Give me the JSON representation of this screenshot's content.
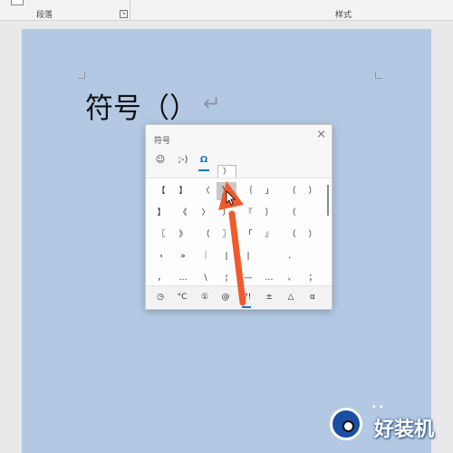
{
  "ribbon": {
    "paragraph_group": "段落",
    "styles_group": "样式"
  },
  "document": {
    "text": "符号（）",
    "paragraph_mark": "↵"
  },
  "symbol_panel": {
    "title": "符号",
    "close": "×",
    "tabs": {
      "emoji": "☺",
      "kaomoji": ";-)",
      "symbols": "Ω"
    },
    "tooltip": "）",
    "grid_rows": [
      [
        "【",
        "】",
        "〈",
        "）",
        "｛",
        "」",
        "（",
        "）"
      ],
      [
        "】",
        "《",
        "〉",
        "）",
        "『",
        "〕",
        "（",
        ""
      ],
      [
        "〖",
        "》",
        "（",
        "〗",
        "「",
        "』",
        "（",
        "）"
      ],
      [
        "‹",
        "»",
        "｜",
        "|",
        "|",
        "",
        "．",
        ""
      ],
      [
        "，",
        "…",
        "\\",
        "¦",
        "—",
        "…",
        "、",
        "；"
      ]
    ],
    "categories": [
      "◷",
      "°C",
      "①",
      "@",
      "?!",
      "±",
      "△",
      "α"
    ]
  },
  "watermark": {
    "text": "好装机",
    "dots": "• •"
  },
  "colors": {
    "page": "#b3c9e3",
    "accent": "#1a73c7",
    "arrow": "#f15a2b"
  }
}
